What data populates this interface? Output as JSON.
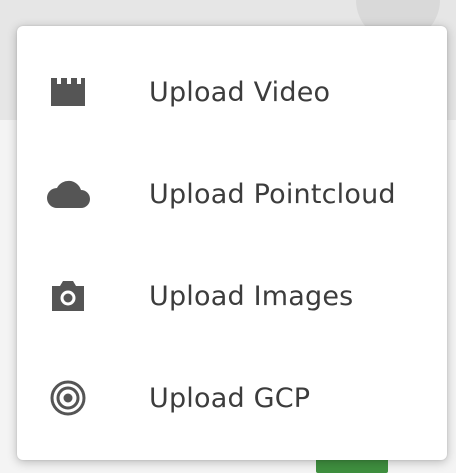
{
  "menu": {
    "items": [
      {
        "label": "Upload Video",
        "icon": "clapperboard-icon"
      },
      {
        "label": "Upload Pointcloud",
        "icon": "cloud-icon"
      },
      {
        "label": "Upload Images",
        "icon": "camera-icon"
      },
      {
        "label": "Upload GCP",
        "icon": "target-icon"
      }
    ]
  },
  "colors": {
    "menu_text": "#3c3c3c",
    "icon": "#555555",
    "accent_green": "#3f8f3f"
  }
}
